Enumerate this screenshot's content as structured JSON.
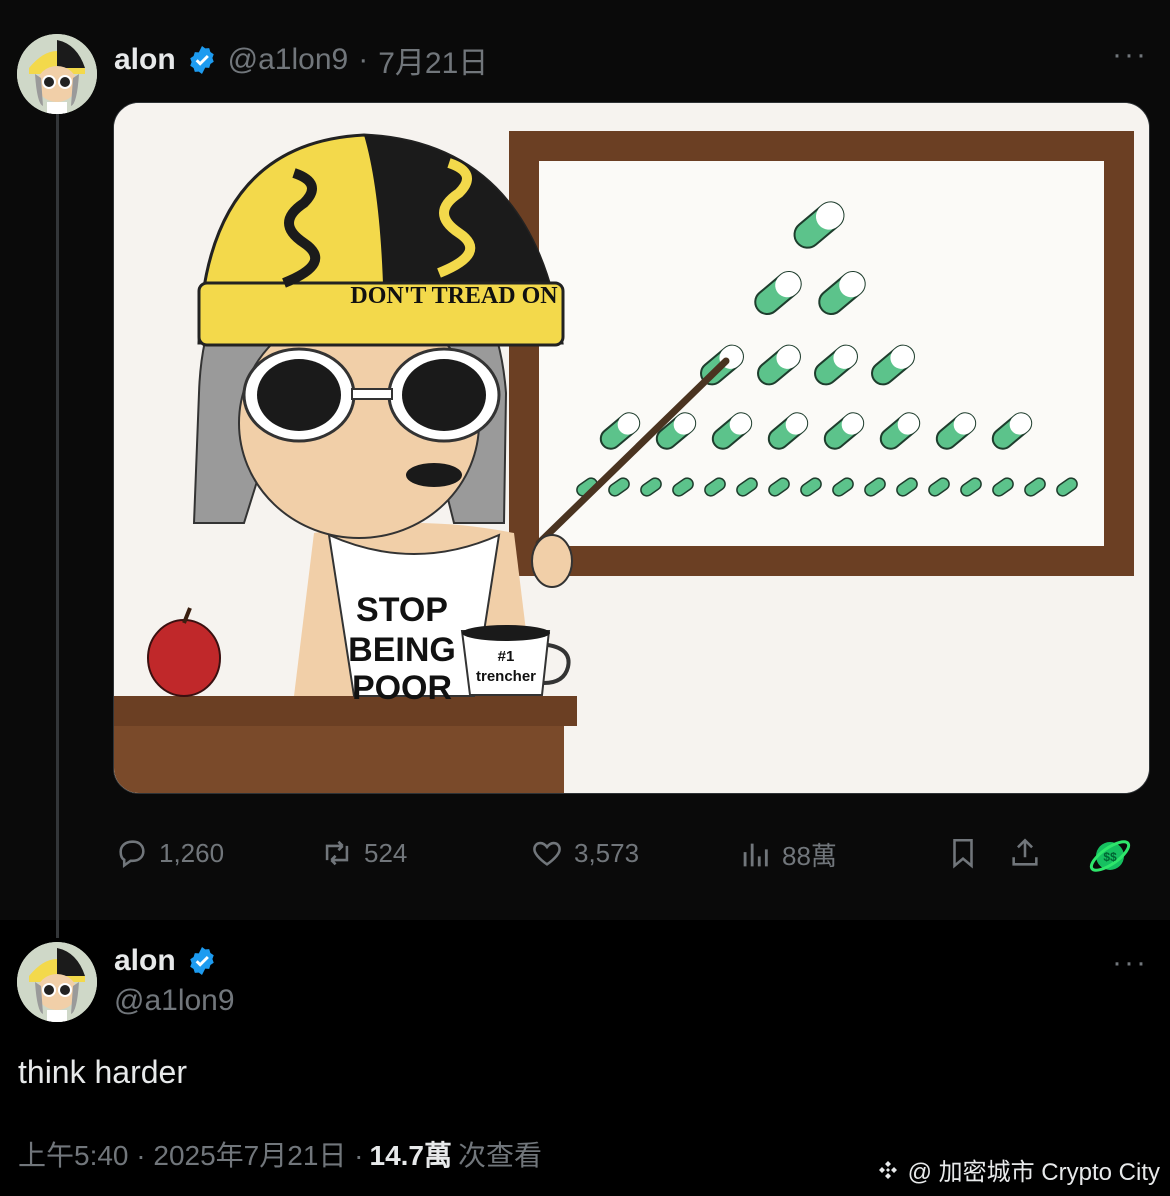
{
  "tweet": {
    "author_name": "alon",
    "handle": "@a1lon9",
    "separator": "·",
    "date": "7月21日",
    "more_label": "···",
    "image": {
      "hat_text": "DON'T TREAD ON",
      "shirt_text_1": "STOP",
      "shirt_text_2": "BEING",
      "shirt_text_3": "POOR",
      "mug_text_1": "#1",
      "mug_text_2": "trencher"
    },
    "actions": {
      "replies": "1,260",
      "reposts": "524",
      "likes": "3,573",
      "views": "88萬"
    }
  },
  "reply": {
    "author_name": "alon",
    "handle": "@a1lon9",
    "more_label": "···",
    "text": "think harder",
    "time": "上午5:40 · 2025年7月21日 ·",
    "views": "14.7萬",
    "views_label": "次查看"
  },
  "watermark": {
    "text": "@ 加密城市 Crypto City"
  },
  "icons": [
    "reply-icon",
    "repost-icon",
    "like-icon",
    "views-icon",
    "bookmark-icon",
    "share-icon",
    "grok-icon",
    "verified-icon"
  ],
  "colors": {
    "verified": "#1d9bf0",
    "pill_green": "#5cc38b",
    "board_frame": "#6b3f23",
    "hat_yellow": "#f3d94b"
  }
}
